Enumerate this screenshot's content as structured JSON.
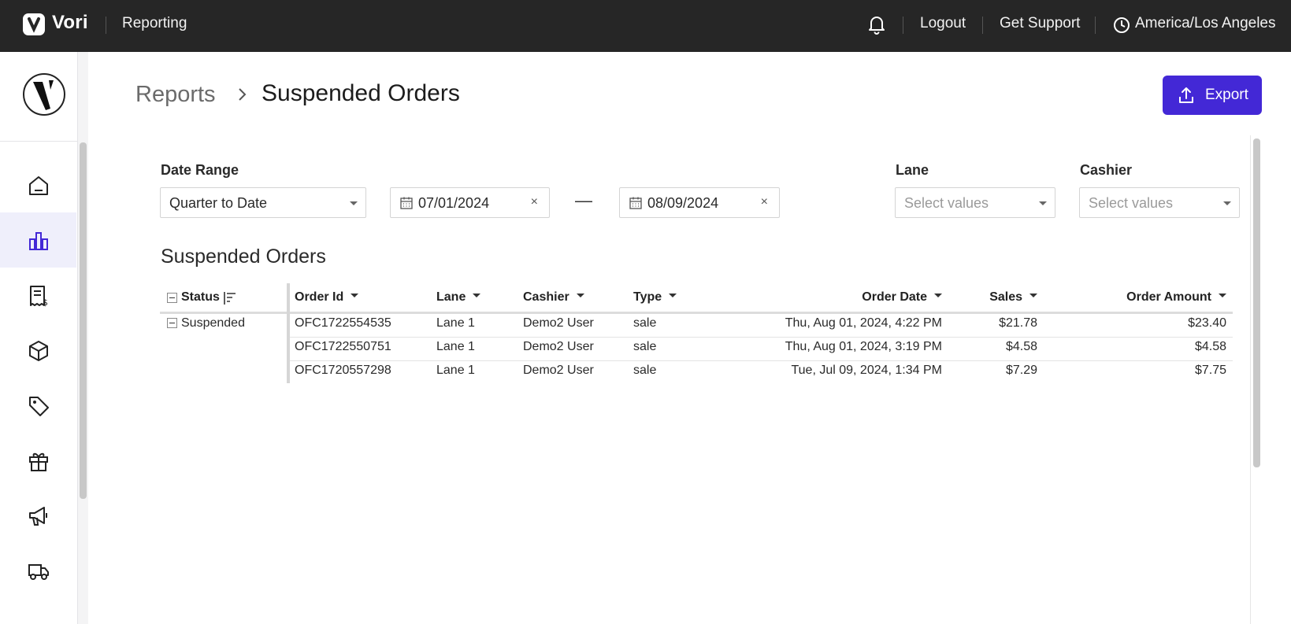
{
  "topbar": {
    "brand": "Vori",
    "section": "Reporting",
    "logout": "Logout",
    "support": "Get Support",
    "timezone": "America/Los Angeles"
  },
  "sidebar": {
    "items": [
      {
        "icon": "home-icon",
        "active": false
      },
      {
        "icon": "bar-chart-icon",
        "active": true
      },
      {
        "icon": "invoice-icon",
        "active": false
      },
      {
        "icon": "box-icon",
        "active": false
      },
      {
        "icon": "tag-icon",
        "active": false
      },
      {
        "icon": "gift-icon",
        "active": false
      },
      {
        "icon": "megaphone-icon",
        "active": false
      },
      {
        "icon": "truck-icon",
        "active": false
      }
    ]
  },
  "breadcrumb": {
    "parent": "Reports",
    "current": "Suspended Orders"
  },
  "export_label": "Export",
  "filters": {
    "date_range_label": "Date Range",
    "date_range_value": "Quarter to Date",
    "start_date": "07/01/2024",
    "end_date": "08/09/2024",
    "lane_label": "Lane",
    "lane_placeholder": "Select values",
    "cashier_label": "Cashier",
    "cashier_placeholder": "Select values"
  },
  "table": {
    "title": "Suspended Orders",
    "columns": {
      "status": "Status",
      "order_id": "Order Id",
      "lane": "Lane",
      "cashier": "Cashier",
      "type": "Type",
      "order_date": "Order Date",
      "sales": "Sales",
      "order_amount": "Order Amount"
    },
    "group": "Suspended",
    "rows": [
      {
        "order_id": "OFC1722554535",
        "lane": "Lane 1",
        "cashier": "Demo2 User",
        "type": "sale",
        "order_date": "Thu, Aug 01, 2024, 4:22 PM",
        "sales": "$21.78",
        "order_amount": "$23.40"
      },
      {
        "order_id": "OFC1722550751",
        "lane": "Lane 1",
        "cashier": "Demo2 User",
        "type": "sale",
        "order_date": "Thu, Aug 01, 2024, 3:19 PM",
        "sales": "$4.58",
        "order_amount": "$4.58"
      },
      {
        "order_id": "OFC1720557298",
        "lane": "Lane 1",
        "cashier": "Demo2 User",
        "type": "sale",
        "order_date": "Tue, Jul 09, 2024, 1:34 PM",
        "sales": "$7.29",
        "order_amount": "$7.75"
      }
    ]
  }
}
